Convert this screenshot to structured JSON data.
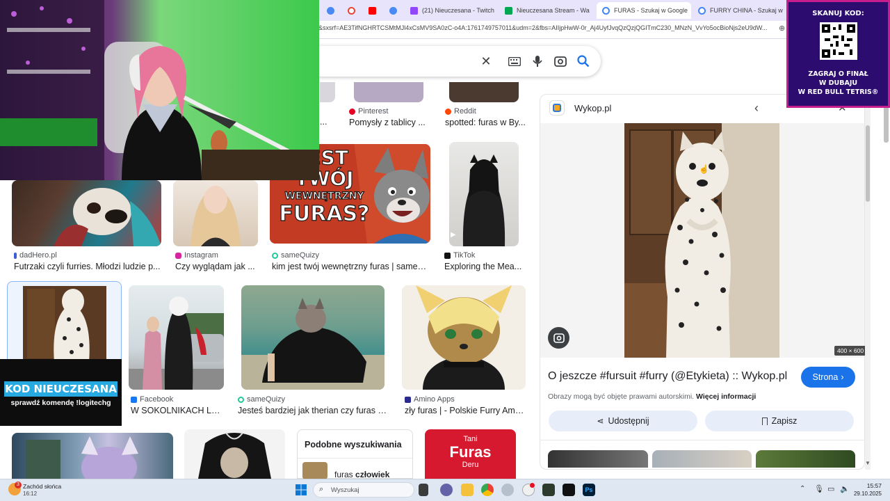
{
  "browser": {
    "tabs": [
      {
        "title": "",
        "color": "#4a8af4"
      },
      {
        "title": "",
        "color": "#ea4335"
      },
      {
        "title": "",
        "color": "#ff0000"
      },
      {
        "title": "",
        "color": "#4a8af4"
      },
      {
        "title": "(21) Nieuczesana - Twitch",
        "color": "#9146ff"
      },
      {
        "title": "Nieuczesana Stream - Wa",
        "color": "#00a651"
      },
      {
        "title": "FURAS - Szukaj w Google",
        "color": "#4285f4"
      },
      {
        "title": "FURRY CHINA - Szukaj w",
        "color": "#4285f4"
      }
    ],
    "url": "&sxsrf=AE3TifNGHRTCSMtMJl4xCsMV9SA0zC-o4A:1761749757011&udm=2&fbs=AIIjpHwW-0r_Aj4UyfJvqQzQzjQGITmC230_MNzN_VvYo5ocBioNjs2eU9dW..."
  },
  "results": {
    "row1": [
      {
        "source": "",
        "title": "..."
      },
      {
        "source": "Pinterest",
        "title": "Pomysły z tablicy ..."
      },
      {
        "source": "Reddit",
        "title": "spotted: furas w By..."
      }
    ],
    "row2": [
      {
        "source": "dadHero.pl",
        "title": "Futrzaki czyli furries. Młodzi ludzie p..."
      },
      {
        "source": "Instagram",
        "title": "Czy wyglądam jak ..."
      },
      {
        "source": "sameQuizy",
        "title": "kim jest twój wewnętrzny furas | sameQ..."
      },
      {
        "source": "TikTok",
        "title": "Exploring the Mea..."
      }
    ],
    "row2_banner": [
      "JEST",
      "TWÓJ",
      "WEWNĘTRZNY",
      "FURAS?"
    ],
    "row3": [
      {
        "source": "Facebook",
        "title": "W SOKOLNIKACH LE..."
      },
      {
        "source": "sameQuizy",
        "title": "Jesteś bardziej jak therian czy furas | ..."
      },
      {
        "source": "Amino Apps",
        "title": "zły furas | - Polskie Furry Ami..."
      }
    ],
    "related": {
      "heading": "Podobne wyszukiwania",
      "item_prefix": "furas ",
      "item_bold": "człowiek"
    },
    "ad_text": {
      "small": "Tani",
      "big": "Furas",
      "sub": "Deru"
    }
  },
  "panel": {
    "site": "Wykop.pl",
    "dimensions": "400 × 600",
    "title": "O jeszcze #fursuit #furry (@Etykieta) :: Wykop.pl",
    "visit_button": "Strona",
    "copyright_text": "Obrazy mogą być objęte prawami autorskimi.",
    "copyright_link": "Więcej informacji",
    "share_button": "Udostępnij",
    "save_button": "Zapisz"
  },
  "overlay": {
    "qr_title": "SKANUJ KOD:",
    "qr_caption": [
      "ZAGRAJ O FINAŁ",
      "W DUBAJU",
      "W RED BULL TETRIS®"
    ],
    "kod_title": "KOD NIEUCZESANA",
    "kod_sub": "sprawdź komendę !logitechg"
  },
  "taskbar": {
    "weather_badge": "3",
    "weather_title": "Zachód słońca",
    "weather_time": "16:12",
    "search_placeholder": "Wyszukaj",
    "clock_time": "15:57",
    "clock_date": "29.10.2025",
    "ps_label": "Ps"
  },
  "colors": {
    "link_blue": "#1a73e8",
    "qr_purple": "#2c0c6e",
    "qr_border": "#c61d8c",
    "kod_blue": "#27a9e1",
    "taskbar_bg": "#dfe7f2"
  }
}
